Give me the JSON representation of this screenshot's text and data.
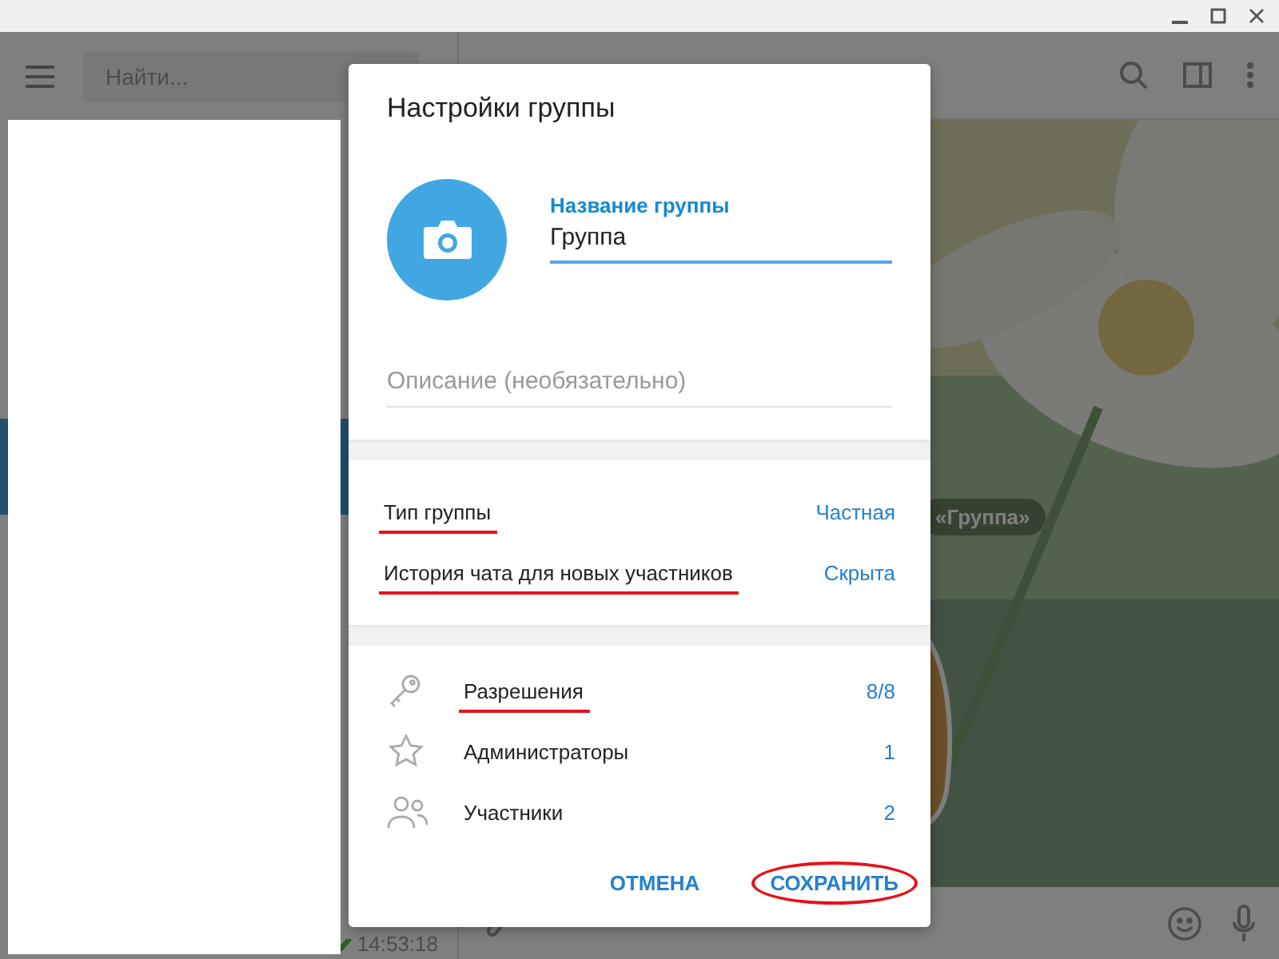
{
  "window": {
    "controls": [
      {
        "kind": "minimize"
      },
      {
        "kind": "maximize"
      },
      {
        "kind": "close"
      }
    ]
  },
  "sidebar": {
    "search": {
      "placeholder": "Найти..."
    },
    "last_time": "14:53:18"
  },
  "chat": {
    "service_message": "«Группа»"
  },
  "dialog": {
    "title": "Настройки группы",
    "name_field": {
      "label": "Название группы",
      "value": "Группа",
      "focused": true
    },
    "description_field": {
      "placeholder": "Описание (необязательно)"
    },
    "settings": [
      {
        "label": "Тип группы",
        "value": "Частная",
        "annotated": true
      },
      {
        "label": "История чата для новых участников",
        "value": "Скрыта",
        "annotated": true
      }
    ],
    "links": [
      {
        "kind": "key",
        "label": "Разрешения",
        "count": "8/8",
        "annotated": true
      },
      {
        "kind": "star",
        "label": "Администраторы",
        "count": "1",
        "annotated": false
      },
      {
        "kind": "people",
        "label": "Участники",
        "count": "2",
        "annotated": false
      }
    ],
    "buttons": [
      {
        "label": "ОТМЕНА",
        "circled": false
      },
      {
        "label": "СОХРАНИТЬ",
        "circled": true
      }
    ]
  }
}
